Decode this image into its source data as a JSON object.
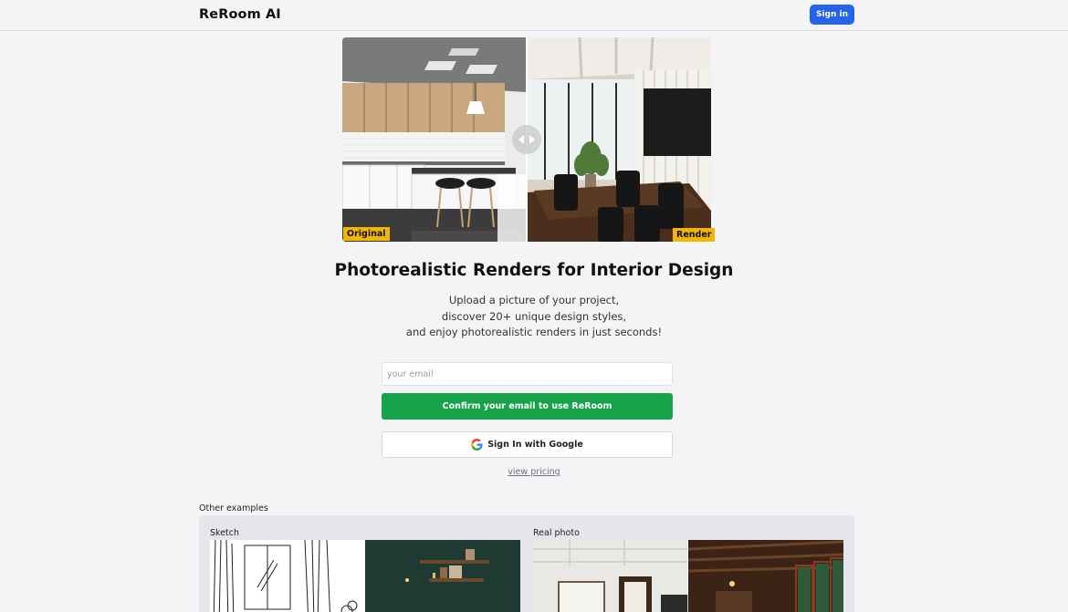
{
  "header": {
    "brand": "ReRoom AI",
    "signin_label": "Sign in"
  },
  "compare": {
    "original_label": "Original",
    "render_label": "Render"
  },
  "hero": {
    "title": "Photorealistic Renders for Interior Design",
    "subtitle_lines": [
      "Upload a picture of your project,",
      "discover 20+ unique design styles,",
      "and enjoy photorealistic renders in just seconds!"
    ]
  },
  "form": {
    "email_placeholder": "your email",
    "email_value": "",
    "confirm_label": "Confirm your email to use ReRoom",
    "google_label": "Sign In with Google",
    "pricing_label": "view pricing"
  },
  "examples": {
    "title": "Other examples",
    "items": [
      {
        "label": "Sketch"
      },
      {
        "label": "Real photo"
      }
    ]
  },
  "colors": {
    "primary": "#2563eb",
    "confirm": "#16a34a",
    "badge": "#f2b705",
    "background": "#f4f4f6"
  }
}
